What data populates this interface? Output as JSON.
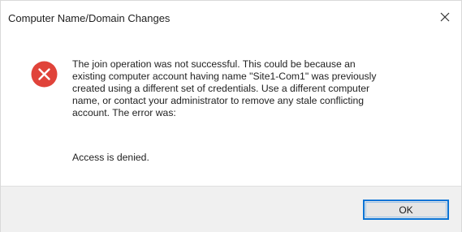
{
  "window": {
    "title": "Computer Name/Domain Changes"
  },
  "icons": {
    "close": "close-icon",
    "status": "error-icon"
  },
  "colors": {
    "error_red": "#e0433a",
    "button_focus_border": "#0a74d6",
    "footer_bg": "#f0f0f0"
  },
  "message": {
    "body": "The join operation was not successful. This could be because an\nexisting computer account having name \"Site1-Com1\" was previously\ncreated using a different set of credentials. Use a different computer\nname, or contact your administrator to remove any stale conflicting\naccount.  The error was:",
    "detail": "Access is denied."
  },
  "buttons": {
    "ok_label": "OK"
  }
}
